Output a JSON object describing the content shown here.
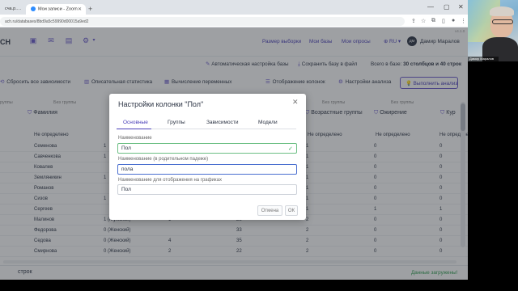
{
  "browser": {
    "tabs": [
      {
        "label": "сча.р.…"
      },
      {
        "label": "Мои записи - Zoom"
      }
    ],
    "new_tab": "+",
    "url": "ach.ru/databases/8bd9a5c59990d00015a9ed2",
    "minimize": "—",
    "maximize": "▢",
    "close": "✕"
  },
  "app": {
    "brand": "CH",
    "version": "v4.1.0",
    "nav": {
      "links": [
        "Размер выборки",
        "Мои базы",
        "Мои опросы"
      ],
      "lang": "RU",
      "avatar_initials": "ДМ",
      "user_name": "Дамир Маралов"
    },
    "subheader": {
      "auto_setup": "Автоматическая настройка базы",
      "save_file": "Сохранить базу в файл",
      "totals_prefix": "Всего в базе:",
      "totals_value": "30 столбцов и 40 строк"
    },
    "toolbar": {
      "reset_deps": "Сбросить все зависимости",
      "descriptive_stats": "Описательная статистика",
      "compute_vars": "Вычисление переменных",
      "show_columns": "Отображение колонок",
      "analysis_settings": "Настройки анализа",
      "run_analysis": "Выполнить анализ"
    }
  },
  "table": {
    "group_labels": [
      "руппы",
      "Без группы",
      "Без группы",
      "Без группы"
    ],
    "headers": {
      "surname": "Фамилия",
      "age_group": "Возрастные группы",
      "obesity": "Ожирение",
      "smoking": "Кур"
    },
    "filter_placeholder": "Не определено",
    "surnames": [
      "Семенова",
      "Савченкова",
      "Ковалев",
      "Земляникин",
      "Романов",
      "Сизов",
      "Сергеев",
      "Малинов",
      "Федорова",
      "Седова",
      "Смирнова"
    ],
    "gender_values": [
      "1 (Мужской)",
      "0 (Женский)",
      "0 (Женский)",
      "0 (Женский)"
    ],
    "gender_codes": [
      "1",
      "4",
      "2"
    ],
    "age_values": [
      "28",
      "33",
      "35",
      "22"
    ],
    "age_group_values": [
      "1",
      "1",
      "1",
      "1",
      "1",
      "1",
      "1",
      "2",
      "2",
      "2",
      "2"
    ],
    "obesity_values": [
      "0",
      "0",
      "0",
      "0",
      "0",
      "0",
      "1",
      "0",
      "0",
      "0",
      "0"
    ],
    "smoking_values": [
      "0",
      "0",
      "0",
      "0",
      "0",
      "0",
      "1",
      "0",
      "0",
      "0",
      "0"
    ],
    "left_values": [
      "1",
      "1",
      "1",
      "1"
    ]
  },
  "footer": {
    "rows_label": "строк",
    "status": "Данные загружены!"
  },
  "modal": {
    "title": "Настройки колонки \"Пол\"",
    "tabs": [
      "Основные",
      "Группы",
      "Зависимости",
      "Модели"
    ],
    "active_tab": "Основные",
    "fields": {
      "name_label": "Наименование",
      "name_value": "Пол",
      "parent_case_label": "Наименование (в родительном падеже)",
      "parent_case_value": "пола",
      "chart_label": "Наименование для отображения на графиках",
      "chart_value": "Пол"
    },
    "cancel": "Отмена",
    "ok": "ОК"
  },
  "webcam": {
    "name": "Дамир Маралов"
  },
  "colors": {
    "accent": "#4a3fb8",
    "success": "#2e9e4f",
    "overlay": "rgba(40,44,52,0.45)"
  }
}
